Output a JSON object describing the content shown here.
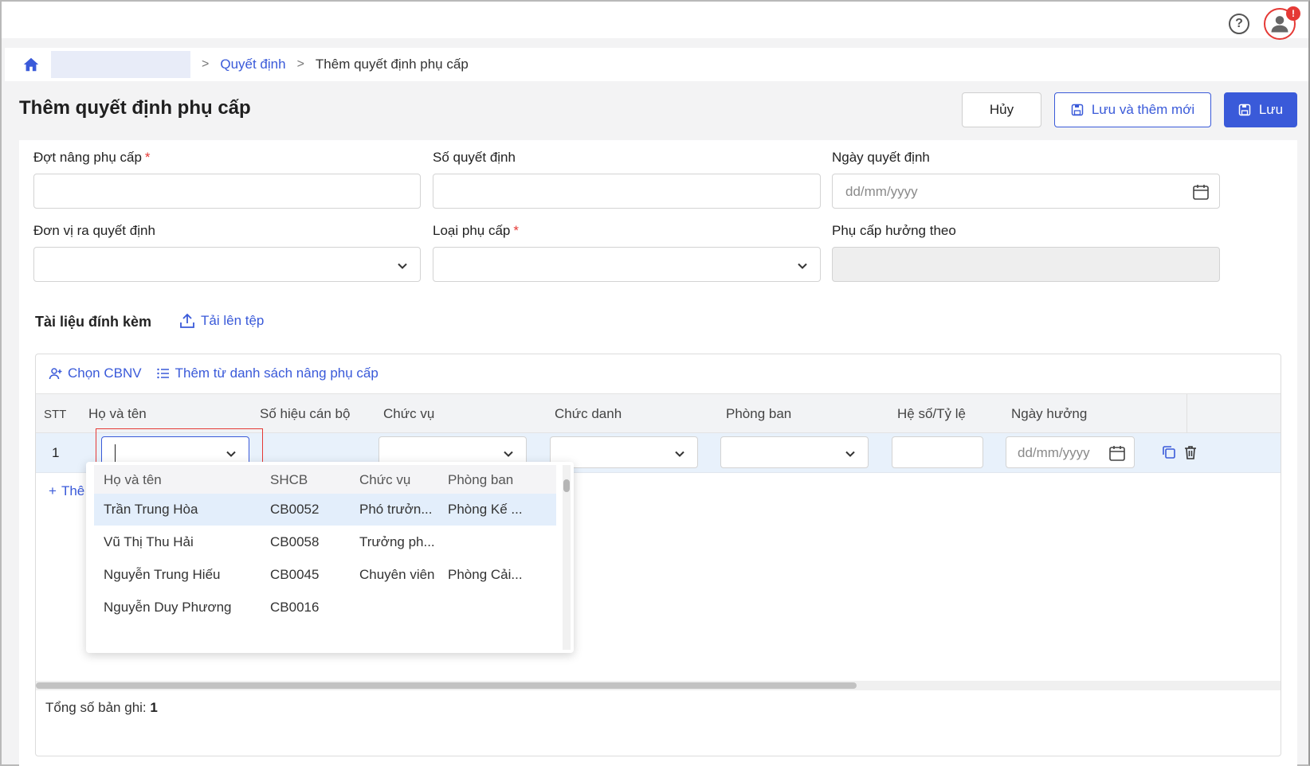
{
  "breadcrumb": {
    "link": "Quyết định",
    "current": "Thêm quyết định phụ cấp",
    "separator": ">"
  },
  "header": {
    "help_glyph": "?",
    "notification_glyph": "!"
  },
  "page": {
    "title": "Thêm quyết định phụ cấp"
  },
  "actions": {
    "cancel": "Hủy",
    "save_new": "Lưu và thêm mới",
    "save": "Lưu"
  },
  "form": {
    "batch_label": "Đợt nâng phụ cấp",
    "decision_no_label": "Số quyết định",
    "decision_date_label": "Ngày quyết định",
    "decision_date_placeholder": "dd/mm/yyyy",
    "issuing_unit_label": "Đơn vị ra quyết định",
    "allowance_type_label": "Loại phụ cấp",
    "allowance_basis_label": "Phụ cấp hưởng theo",
    "required_mark": "*"
  },
  "attachments": {
    "title": "Tài liệu đính kèm",
    "upload": "Tải lên tệp"
  },
  "grid": {
    "toolbar": {
      "choose_employee": "Chọn CBNV",
      "add_from_list": "Thêm từ danh sách nâng phụ cấp"
    },
    "columns": [
      "STT",
      "Họ và tên",
      "Số hiệu cán bộ",
      "Chức vụ",
      "Chức danh",
      "Phòng ban",
      "Hệ số/Tỷ lệ",
      "Ngày hưởng"
    ],
    "row": {
      "stt": "1",
      "date_placeholder": "dd/mm/yyyy"
    },
    "add_row_label": "Thê",
    "add_row_glyph": "+",
    "total_label": "Tổng số bản ghi:",
    "total_value": "1"
  },
  "dropdown": {
    "columns": [
      "Họ và tên",
      "SHCB",
      "Chức vụ",
      "Phòng ban"
    ],
    "rows": [
      {
        "name": "Trần Trung Hòa",
        "code": "CB0052",
        "position": "Phó trưởn...",
        "department": "Phòng Kế ..."
      },
      {
        "name": "Vũ Thị Thu Hải",
        "code": "CB0058",
        "position": "Trưởng ph...",
        "department": ""
      },
      {
        "name": "Nguyễn Trung Hiếu",
        "code": "CB0045",
        "position": "Chuyên viên",
        "department": "Phòng Cải..."
      },
      {
        "name": "Nguyễn Duy Phương",
        "code": "CB0016",
        "position": "",
        "department": ""
      }
    ]
  },
  "colors": {
    "primary": "#3a5ad9",
    "danger": "#e53935",
    "row_highlight": "#e8f1fb"
  }
}
